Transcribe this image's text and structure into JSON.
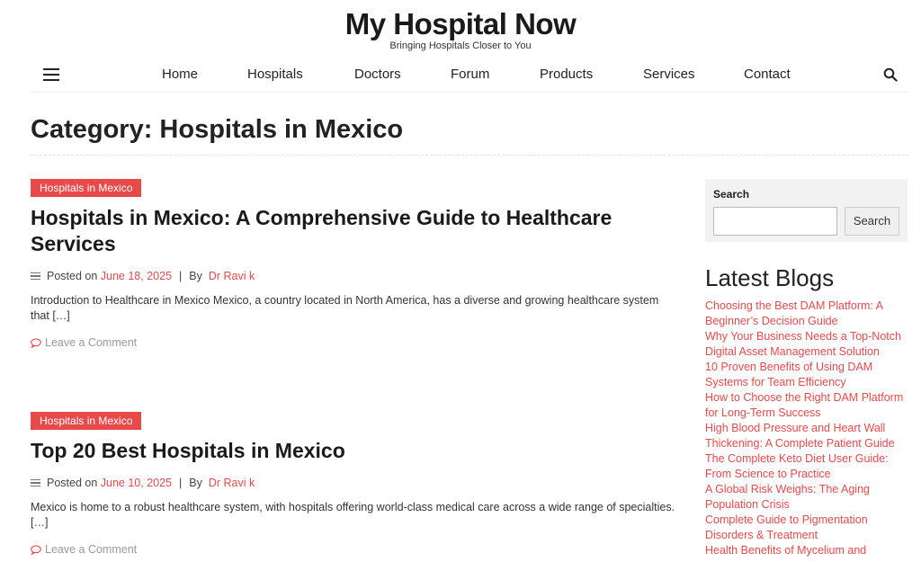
{
  "site": {
    "title": "My Hospital Now",
    "tagline": "Bringing Hospitals Closer to You"
  },
  "nav": {
    "items": [
      "Home",
      "Hospitals",
      "Doctors",
      "Forum",
      "Products",
      "Services",
      "Contact"
    ]
  },
  "category": {
    "title": "Category: Hospitals in Mexico"
  },
  "posts": [
    {
      "tag": "Hospitals in Mexico",
      "title": "Hospitals in Mexico: A Comprehensive Guide to Healthcare Services",
      "posted_on": "Posted on",
      "date": "June 18, 2025",
      "sep": "|",
      "by": "By",
      "author": "Dr Ravi k",
      "excerpt": "Introduction to Healthcare in Mexico Mexico, a country located in North America, has a diverse and growing healthcare system that […]",
      "comment": "Leave a Comment"
    },
    {
      "tag": "Hospitals in Mexico",
      "title": "Top 20 Best Hospitals in Mexico",
      "posted_on": "Posted on",
      "date": "June 10, 2025",
      "sep": "|",
      "by": "By",
      "author": "Dr Ravi k",
      "excerpt": "Mexico is home to a robust healthcare system, with hospitals offering world-class medical care across a wide range of specialties. […]",
      "comment": "Leave a Comment"
    }
  ],
  "sidebar": {
    "search_label": "Search",
    "search_button": "Search",
    "latest_title": "Latest Blogs",
    "blogs": [
      "Choosing the Best DAM Platform: A Beginner’s Decision Guide",
      "Why Your Business Needs a Top-Notch Digital Asset Management Solution",
      "10 Proven Benefits of Using DAM Systems for Team Efficiency",
      "How to Choose the Right DAM Platform for Long-Term Success",
      "High Blood Pressure and Heart Wall Thickening: A Complete Patient Guide",
      "The Complete Keto Diet User Guide: From Science to Practice",
      "A Global Risk Weighs: The Aging Population Crisis",
      "Complete Guide to Pigmentation Disorders & Treatment",
      "Health Benefits of Mycelium and"
    ]
  },
  "colors": {
    "accent": "#e84a4a",
    "text": "#222222",
    "muted": "#999999"
  }
}
